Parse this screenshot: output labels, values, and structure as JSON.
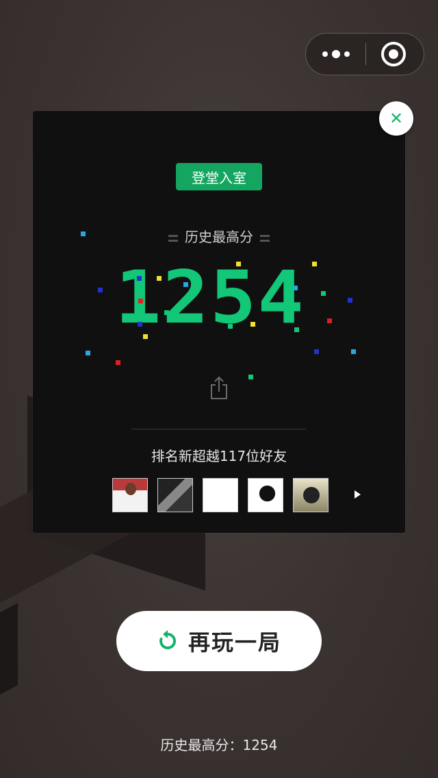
{
  "menu_capsule": {
    "more_icon": "more-dots-icon",
    "exit_icon": "target-circle-icon"
  },
  "card": {
    "close_icon": "close-icon",
    "badge": "登堂入室",
    "best_label": "历史最高分",
    "best_score_digits": [
      "1",
      "2",
      "5",
      "4"
    ],
    "share_icon": "share-icon",
    "rank_text": "排名新超越117位好友",
    "friends": [
      {
        "avatar": "friend-avatar-1"
      },
      {
        "avatar": "friend-avatar-2"
      },
      {
        "avatar": "friend-avatar-3"
      },
      {
        "avatar": "friend-avatar-4"
      },
      {
        "avatar": "friend-avatar-5"
      }
    ],
    "next_icon": "play-arrow-icon"
  },
  "replay_button": {
    "label": "再玩一局",
    "icon": "replay-icon"
  },
  "footer": {
    "text": "历史最高分：1254"
  },
  "colors": {
    "accent_green": "#12c777",
    "badge_green": "#14a660",
    "card_bg": "#111010"
  }
}
